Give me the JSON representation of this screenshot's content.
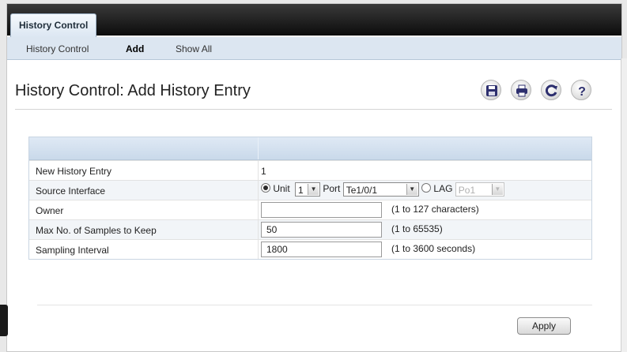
{
  "tabs": [
    {
      "label": "History Control"
    }
  ],
  "subnav": [
    {
      "label": "History Control"
    },
    {
      "label": "Add"
    },
    {
      "label": "Show All"
    }
  ],
  "page": {
    "title": "History Control: Add History Entry"
  },
  "toolbar": [
    {
      "icon": "save-icon"
    },
    {
      "icon": "print-icon"
    },
    {
      "icon": "refresh-icon"
    },
    {
      "icon": "help-icon"
    }
  ],
  "form": {
    "rows": [
      {
        "label": "New History Entry",
        "value": "1"
      },
      {
        "label": "Source Interface"
      },
      {
        "label": "Owner",
        "value": "",
        "hint": "(1 to 127 characters)"
      },
      {
        "label": "Max No. of Samples to Keep",
        "value": "50",
        "hint": "(1 to 65535)"
      },
      {
        "label": "Sampling Interval",
        "value": "1800",
        "hint": "(1 to 3600 seconds)"
      }
    ],
    "source": {
      "unit_label": "Unit",
      "unit_value": "1",
      "port_label": "Port",
      "port_value": "Te1/0/1",
      "lag_label": "LAG",
      "lag_value": "Po1",
      "selected": "Unit"
    }
  },
  "actions": {
    "apply_label": "Apply"
  },
  "colors": {
    "tabbar": "#0c0c0c",
    "subnav": "#dce6f1",
    "table_header": "#c9d9ea"
  }
}
